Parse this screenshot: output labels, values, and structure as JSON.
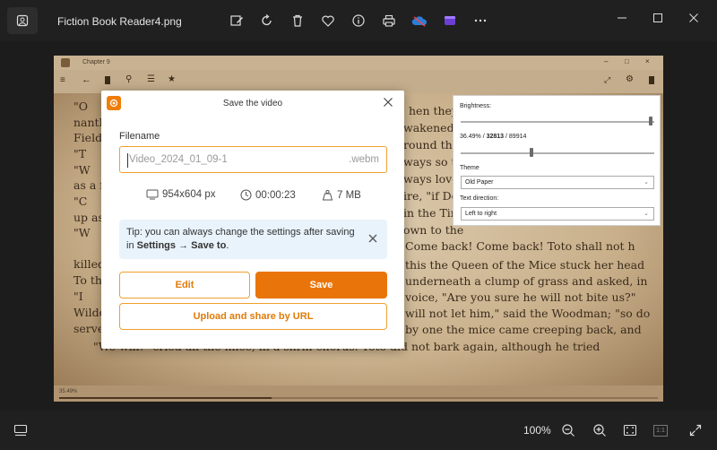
{
  "window": {
    "title": "Fiction Book Reader4.png",
    "toolbar_icons": [
      "edit-image-icon",
      "rotate-icon",
      "delete-icon",
      "favorite-icon",
      "info-icon",
      "print-icon",
      "onedrive-icon",
      "clipchamp-icon",
      "more-icon"
    ],
    "controls": [
      "minimize-icon",
      "maximize-icon",
      "close-icon"
    ]
  },
  "reader": {
    "chapter": "Chapter 9",
    "lines": [
      "\"O",
      "nanth",
      "Field",
      "\"T",
      "\"W",
      "as a f",
      "\"C",
      "up as",
      "\"W",
      "killed",
      "To th",
      "\"I",
      "Wildo",
      "serve",
      "\"We will!\" cried all the mice, in a shrill chorus.    Toto did not bark again, although he tried"
    ],
    "right_lines": [
      "hen they s",
      "wakened t",
      "round the",
      "ways so t",
      "ways love",
      "ire, \"if Dor",
      "in the Tin",
      "own to the",
      "Come back! Come back! Toto shall not h",
      "this the Queen of the Mice stuck her head",
      "underneath a clump of grass and asked, in",
      "voice, \"Are you sure he will not bite us?\"",
      "will not let him,\" said the Woodman; \"so do",
      "by one the mice came creeping back, and"
    ],
    "footer_percent": "35.49%",
    "progress": 0.355
  },
  "settings": {
    "brightness_label": "Brightness:",
    "brightness_level": 0.98,
    "position_percent": "36.49%",
    "position_current": "32813",
    "position_total": "89914",
    "position_level": 0.365,
    "theme_label": "Theme",
    "theme_value": "Old Paper",
    "text_direction_label": "Text direction:",
    "text_direction_value": "Left to right"
  },
  "dialog": {
    "title": "Save the video",
    "filename_label": "Filename",
    "filename_value": "Video_2024_01_09-1",
    "extension": ".webm",
    "resolution": "954x604 px",
    "duration": "00:00:23",
    "size": "7 MB",
    "tip_prefix": "Tip: you can always change the settings after saving in ",
    "tip_settings": "Settings",
    "tip_arrow": " → ",
    "tip_save_to": "Save to",
    "tip_suffix": ".",
    "edit_button": "Edit",
    "save_button": "Save",
    "upload_button": "Upload and share by URL"
  },
  "bottom": {
    "zoom": "100%",
    "actual_size": "1:1"
  },
  "colors": {
    "accent": "#e9750a",
    "accent_border": "#f0a030",
    "tip_bg": "#e9f3fb",
    "window_bg": "#202020"
  }
}
